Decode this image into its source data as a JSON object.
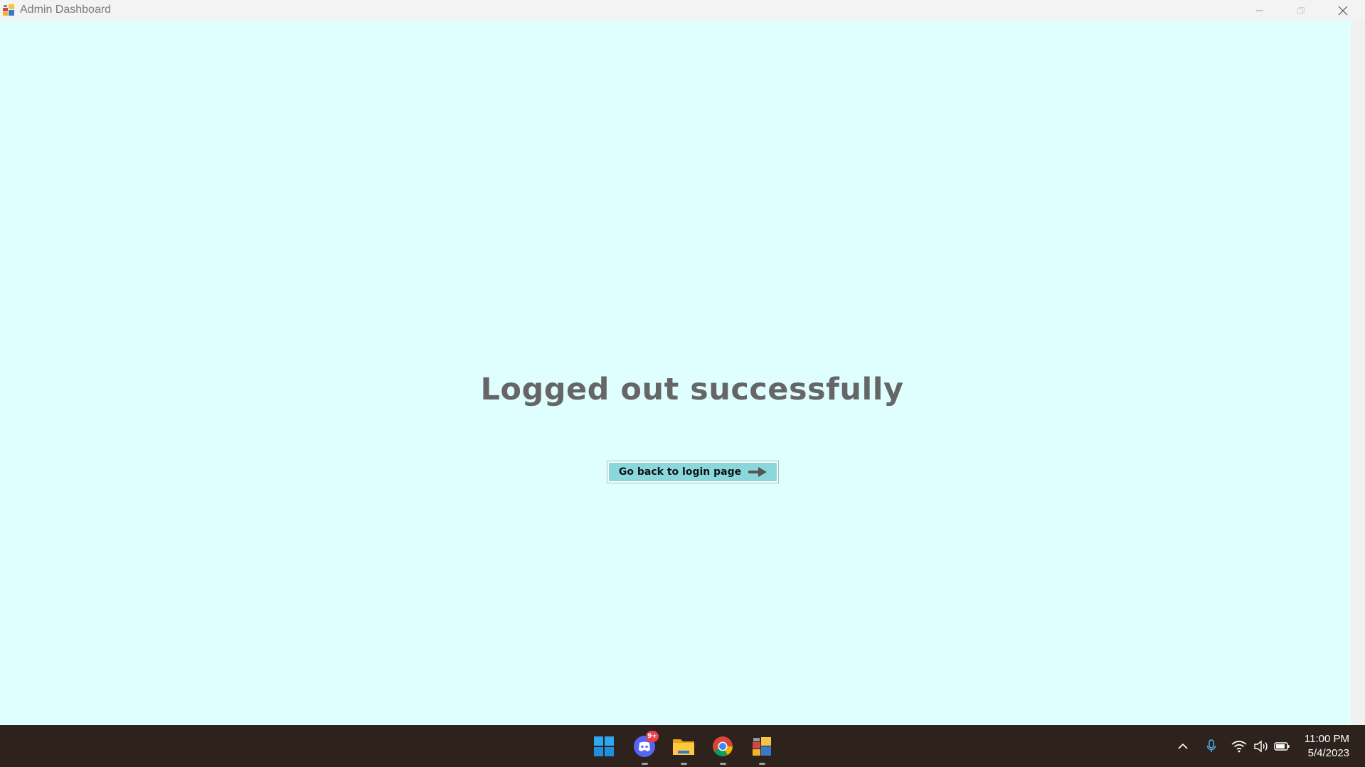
{
  "window": {
    "title": "Admin Dashboard",
    "controls": [
      "minimize",
      "maximize",
      "close"
    ]
  },
  "main": {
    "message": "Logged out successfully",
    "login_button_label": "Go back to login page",
    "login_button_icon": "arrow-right-icon"
  },
  "colors": {
    "content_background": "#dfffff",
    "button_fill": "#8ad8dc",
    "message_text": "#666666",
    "taskbar": "#2e221d"
  },
  "taskbar": {
    "apps": [
      {
        "name": "Start",
        "icon": "windows-start-icon"
      },
      {
        "name": "Discord",
        "icon": "discord-icon",
        "badge": "9+"
      },
      {
        "name": "File Explorer",
        "icon": "folder-icon"
      },
      {
        "name": "Google Chrome",
        "icon": "chrome-icon"
      },
      {
        "name": "Admin Dashboard",
        "icon": "app-icon"
      }
    ],
    "tray": [
      "chevron-up-icon",
      "microphone-icon",
      "wifi-icon",
      "volume-icon",
      "battery-icon"
    ],
    "time": "11:00 PM",
    "date": "5/4/2023"
  }
}
